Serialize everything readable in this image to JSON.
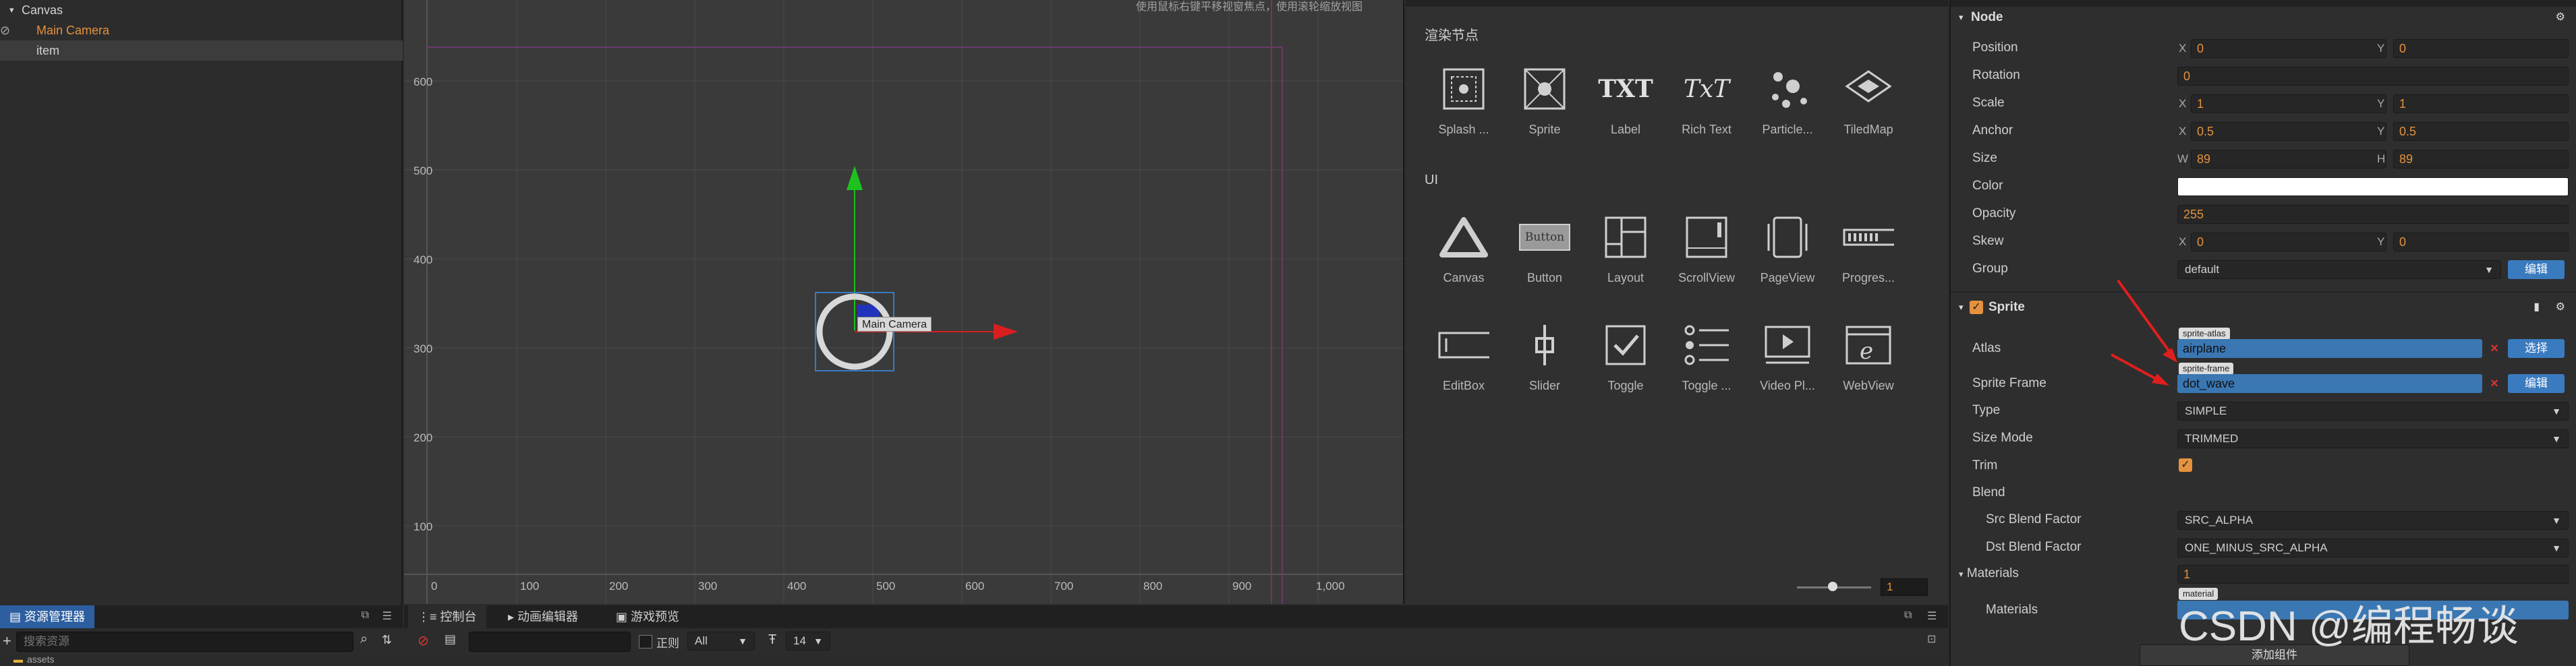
{
  "hierarchy": {
    "items": [
      {
        "label": "Canvas"
      },
      {
        "label": "Main Camera"
      },
      {
        "label": "item"
      }
    ]
  },
  "scene": {
    "hint": "使用鼠标右键平移视窗焦点，使用滚轮缩放视图",
    "y_ticks": [
      "600",
      "500",
      "400",
      "300",
      "200",
      "100"
    ],
    "x_ticks": [
      "0",
      "100",
      "200",
      "300",
      "400",
      "500",
      "600",
      "700",
      "800",
      "900",
      "1,000"
    ],
    "camera_label": "Main Camera"
  },
  "library": {
    "render_title": "渲染节点",
    "render_items": [
      "Splash ...",
      "Sprite",
      "Label",
      "Rich Text",
      "Particle...",
      "TiledMap"
    ],
    "ui_title": "UI",
    "ui_items_row1": [
      "Canvas",
      "Button",
      "Layout",
      "ScrollView",
      "PageView",
      "Progres..."
    ],
    "ui_items_row2": [
      "EditBox",
      "Slider",
      "Toggle",
      "Toggle ...",
      "Video Pl...",
      "WebView"
    ],
    "button_icon_text": "Button",
    "txt_icon": "TXT",
    "richtxt_icon": "TxT",
    "zoom_value": "1"
  },
  "bottom": {
    "assets_tab": "资源管理器",
    "assets_search_placeholder": "搜索资源",
    "assets_first_item": "assets",
    "console_tab": "控制台",
    "anim_tab": "动画编辑器",
    "preview_tab": "游戏预览",
    "regex_label": "正则",
    "filter_value": "All",
    "font_size_value": "14"
  },
  "inspector": {
    "node_title": "Node",
    "position_label": "Position",
    "position_x": "0",
    "position_y": "0",
    "rotation_label": "Rotation",
    "rotation": "0",
    "scale_label": "Scale",
    "scale_x": "1",
    "scale_y": "1",
    "anchor_label": "Anchor",
    "anchor_x": "0.5",
    "anchor_y": "0.5",
    "size_label": "Size",
    "size_w": "89",
    "size_h": "89",
    "color_label": "Color",
    "opacity_label": "Opacity",
    "opacity": "255",
    "skew_label": "Skew",
    "skew_x": "0",
    "skew_y": "0",
    "group_label": "Group",
    "group": "default",
    "edit_btn": "编辑",
    "x_letter": "X",
    "y_letter": "Y",
    "w_letter": "W",
    "h_letter": "H",
    "sprite_title": "Sprite",
    "atlas_label": "Atlas",
    "atlas_tag": "sprite-atlas",
    "atlas_value": "airplane",
    "select_btn": "选择",
    "frame_label": "Sprite Frame",
    "frame_tag": "sprite-frame",
    "frame_value": "dot_wave",
    "frame_edit_btn": "编辑",
    "type_label": "Type",
    "type": "SIMPLE",
    "size_mode_label": "Size Mode",
    "size_mode": "TRIMMED",
    "trim_label": "Trim",
    "blend_label": "Blend",
    "src_blend_label": "Src Blend Factor",
    "src_blend": "SRC_ALPHA",
    "dst_blend_label": "Dst Blend Factor",
    "dst_blend": "ONE_MINUS_SRC_ALPHA",
    "materials_title": "Materials",
    "materials_count": "1",
    "materials_label": "Materials",
    "material_tag": "material",
    "add_component": "添加组件"
  },
  "watermark": "CSDN @编程畅谈",
  "colors": {
    "accent": "#3a7bbf",
    "orange": "#e4923d",
    "selected_tab": "#2d5fa0"
  }
}
